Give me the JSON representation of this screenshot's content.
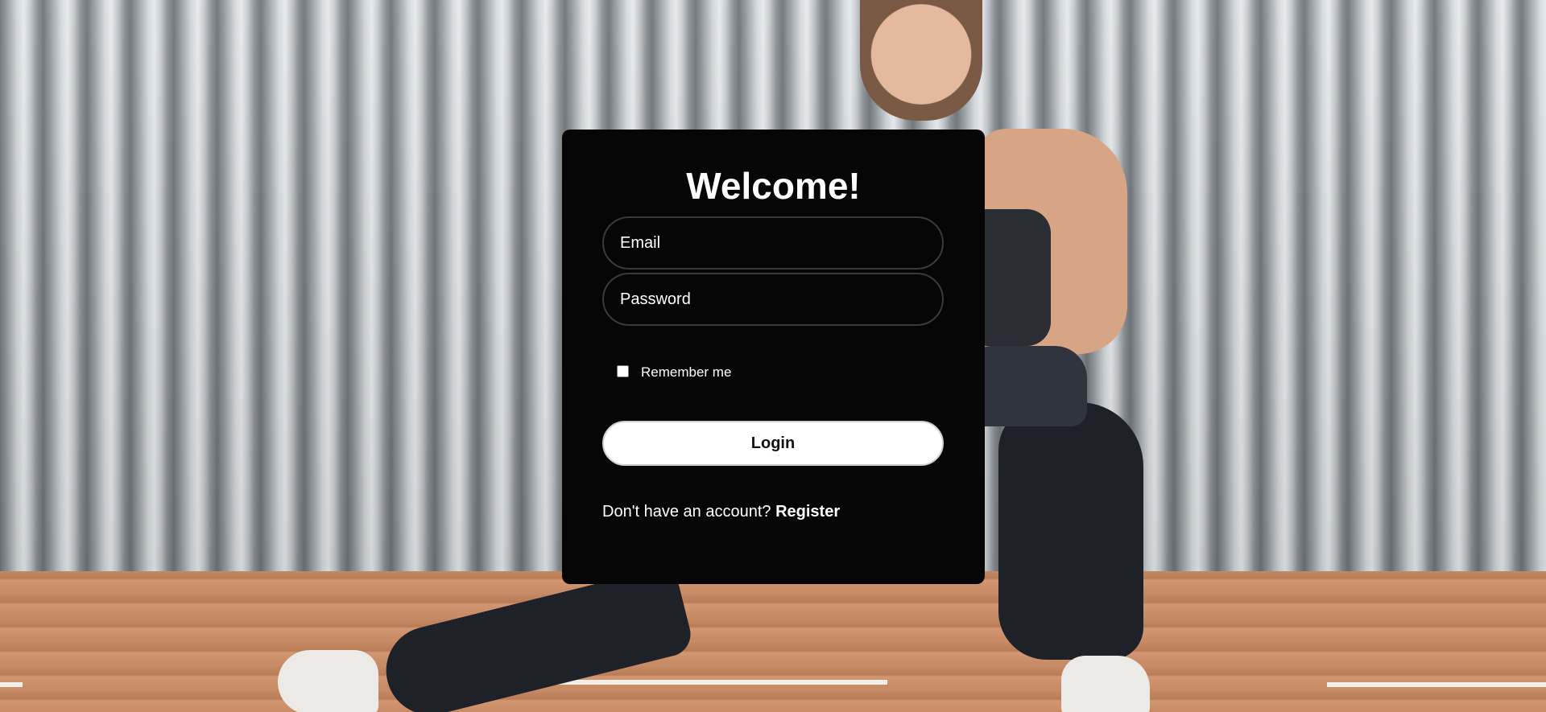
{
  "login": {
    "title": "Welcome!",
    "email_placeholder": "Email",
    "password_placeholder": "Password",
    "remember_label": "Remember me",
    "remember_checked": false,
    "login_label": "Login",
    "register_prompt": "Don't have an account?",
    "register_link": "Register"
  },
  "colors": {
    "card_bg": "#060606",
    "text": "#ffffff",
    "button_bg": "#ffffff",
    "button_text": "#111111"
  }
}
